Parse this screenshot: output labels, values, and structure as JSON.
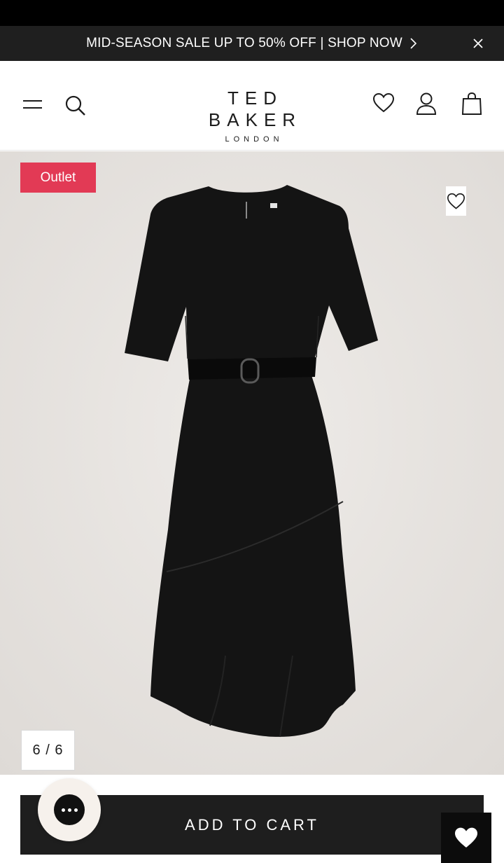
{
  "promo": {
    "text": "MID-SEASON SALE UP TO 50% OFF | SHOP NOW",
    "chevron_icon": "chevron-right-icon",
    "close_icon": "close-icon"
  },
  "header": {
    "brand": "TED BAKER",
    "brand_sub": "LONDON",
    "icons": [
      "menu-icon",
      "search-icon",
      "wishlist-icon",
      "account-icon",
      "bag-icon"
    ]
  },
  "product": {
    "badge": "Outlet",
    "badge_color": "#e23a55",
    "image_counter": "6 / 6",
    "favorite_icon": "heart-outline-icon",
    "image_alt": "black belted midi dress"
  },
  "cart": {
    "add_label": "ADD TO CART"
  },
  "chat": {
    "icon": "chat-bubble-icon"
  },
  "wishlist_fab": {
    "icon": "heart-filled-icon"
  },
  "colors": {
    "banner_bg": "#1f1f1f",
    "gallery_bg": "#e5e2df",
    "cart_bg": "#1e1e1e",
    "accent": "#e23a55"
  }
}
